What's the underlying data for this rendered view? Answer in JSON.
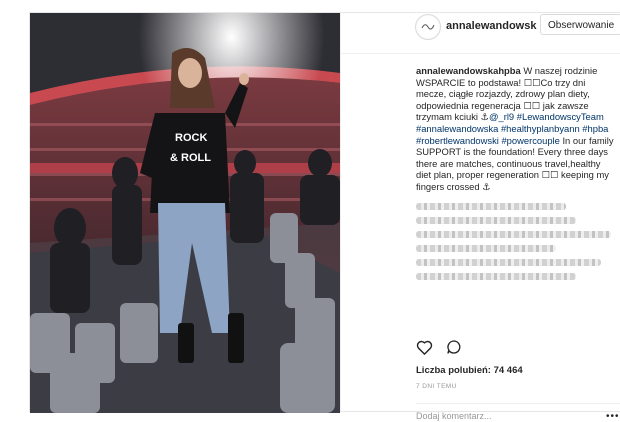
{
  "post": {
    "username": "annalewandowsk",
    "follow_label": "Obserwowanie",
    "caption": {
      "author": "annalewandowskahpba",
      "text_pl_1": " W naszej rodzinie WSPARCIE to podstawa! ",
      "text_pl_2": "Co trzy dni mecze, ciągłe rozjazdy, zdrowy plan diety, odpowiednia regeneracja ",
      "text_pl_3": " jak zawsze trzymam kciuki ",
      "mention": "@_rl9",
      "hashtags": [
        "#LewandowscyTeam",
        "#annalewandowska",
        "#healthyplanbyann",
        "#hpba",
        "#robertlewandowski",
        "#powercouple"
      ],
      "text_en": " In our family SUPPORT is the foundation! Every three days there are matches, continuous travel,healthy diet plan, proper regeneration ",
      "text_en_2": " keeping my fingers crossed "
    },
    "likes_label": "Liczba polubień: 74 464",
    "time_ago": "7 DNI TEMU",
    "comment_placeholder": "Dodaj komentarz...",
    "more_label": "•••",
    "photo_shirt_text_1": "ROCK",
    "photo_shirt_text_2": "& ROLL"
  }
}
